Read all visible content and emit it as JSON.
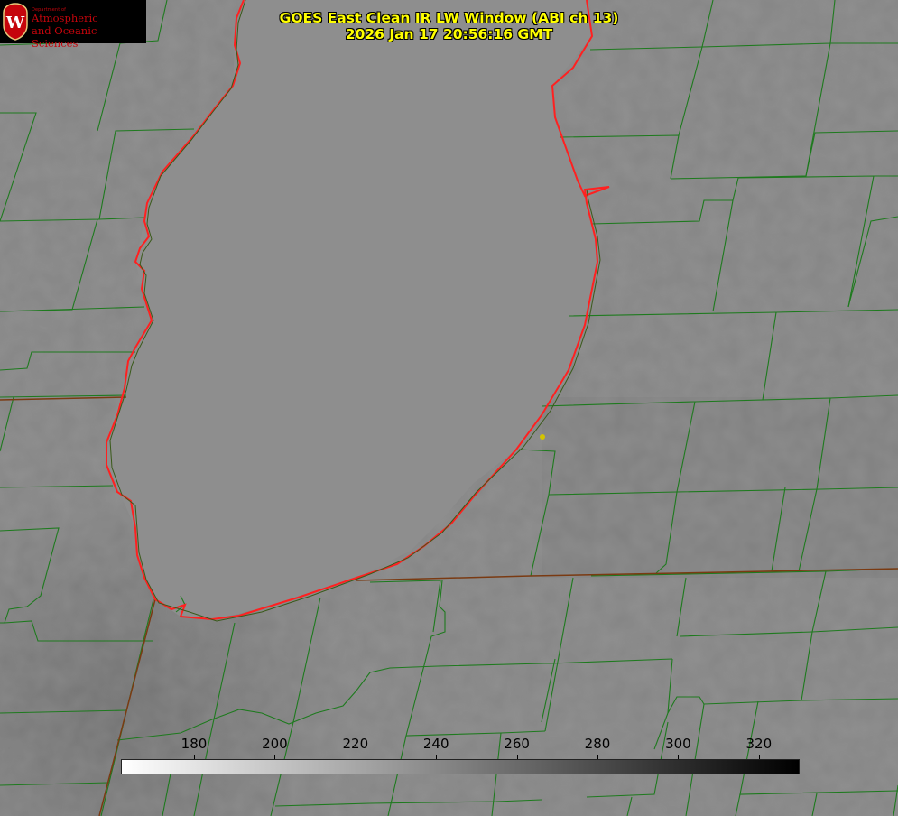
{
  "title": {
    "line1": "GOES East Clean IR LW Window (ABI ch 13)",
    "line2": "2026 Jan 17 20:56:16 GMT"
  },
  "logo": {
    "department": "Department of",
    "line1": "Atmospheric",
    "line2": "and Oceanic Sciences",
    "seal_letter": "W"
  },
  "colorbar": {
    "ticks": [
      "180",
      "200",
      "220",
      "240",
      "260",
      "280",
      "300",
      "320"
    ],
    "gradient": [
      "#ffffff",
      "#000000"
    ]
  },
  "colors": {
    "boundary": "#1e7a1e",
    "lake_outline": "#ff2020",
    "title": "#ffff00",
    "marker": "#ffd700"
  }
}
